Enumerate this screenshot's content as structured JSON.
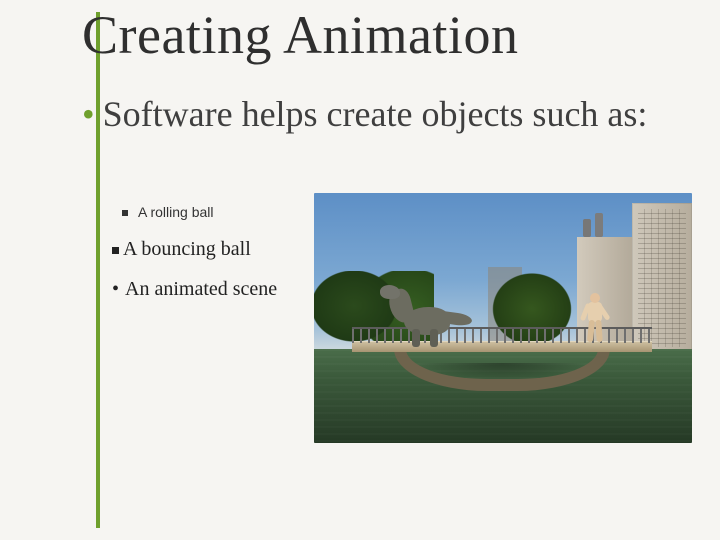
{
  "title": "Creating Animation",
  "bullet_main": "Software helps create objects such as:",
  "sub_items": {
    "rolling": "A rolling ball",
    "bouncing": "A bouncing ball",
    "scene": "An animated scene"
  }
}
